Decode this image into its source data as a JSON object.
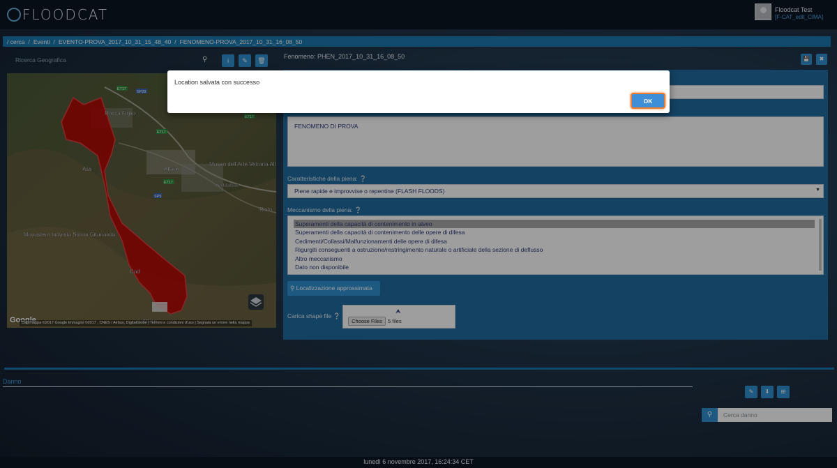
{
  "app": {
    "logo_text": "FLOODCAT",
    "user_name": "Floodcat Test",
    "user_role": "[F-CAT_edit_CIMA]"
  },
  "breadcrumb": [
    "/ cerca",
    "/",
    "Eventi",
    "/",
    "EVENTO-PROVA_2017_10_31_15_48_40",
    "/",
    "FENOMENO-PROVA_2017_10_31_16_08_50"
  ],
  "left_panel": {
    "geo_search_placeholder": "Ricerca Geografica",
    "icons": [
      "search-icon",
      "info-icon",
      "edit-icon",
      "trash-icon"
    ]
  },
  "map": {
    "labels": [
      "Rocca Figlio",
      "Museo dell'Arte Vetraria Altarese",
      "Altare",
      "Via Mallare",
      "Monastero Induista Svami Gitananda",
      "Risto",
      "Ass",
      "Cad",
      "Altare"
    ],
    "road_badges": [
      "E717",
      "SP29",
      "E717",
      "E717",
      "E717",
      "SP5"
    ],
    "google_logo": "Google",
    "attribution": "Dati mappa ©2017 Google Immagini ©2017 , CNES / Airbus, DigitalGlobe | Termini e condizioni d'uso | Segnala un errore nella mappa",
    "polygon_color": "#c00000"
  },
  "form": {
    "title": "Fenomeno: PHEN_2017_10_31_16_08_50",
    "description_value": "FENOMENO DI PROVA",
    "caratteristiche_label": "Caratteristiche della piena:",
    "caratteristiche_value": "Piene rapide e improvvise o repentine (FLASH FLOODS)",
    "meccanismo_label": "Meccanismo della piena:",
    "meccanismo_options": [
      "Superamenti della capacità di contenimento in alveo",
      "Superamenti della capacità di contenimento delle opere di difesa",
      "Cedimenti/Collassi/Malfunzionamenti delle opere di difesa",
      "Rigurgiti conseguenti a ostruzione/restringimento naturale o artificiale della sezione di deflusso",
      "Altro meccanismo",
      "Dato non disponibile"
    ],
    "meccanismo_selected_index": 0,
    "localizzazione_button": "Localizzazione approssimata",
    "shape_label": "Carica shape file",
    "choose_files_button": "Choose Files",
    "files_count": "5 files",
    "accent": "#2f90cf"
  },
  "danno": {
    "title": "Danno",
    "search_placeholder": "Cerca danno"
  },
  "footer": {
    "datetime": "lunedì 6 novembre 2017, 16:24:34 CET"
  },
  "modal": {
    "message": "Location salvata con successo",
    "ok_label": "OK"
  }
}
